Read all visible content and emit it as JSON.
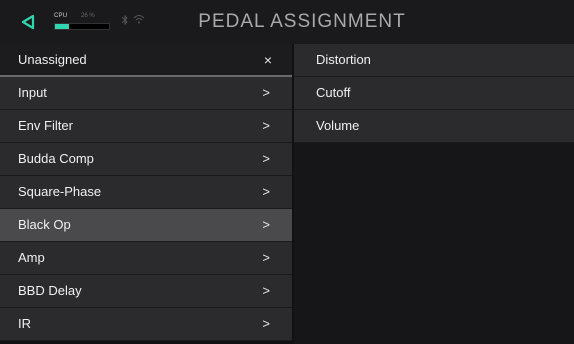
{
  "header": {
    "title": "PEDAL ASSIGNMENT",
    "cpu_label": "CPU",
    "cpu_percent": "26 %",
    "cpu_level": 0.26,
    "accent": "#2fd6b0",
    "icons": [
      "back-arrow-icon",
      "bluetooth-icon",
      "wifi-icon"
    ]
  },
  "left": {
    "unassigned": "Unassigned",
    "items": [
      {
        "label": "Input"
      },
      {
        "label": "Env Filter"
      },
      {
        "label": "Budda Comp"
      },
      {
        "label": "Square-Phase"
      },
      {
        "label": "Black Op",
        "selected": true
      },
      {
        "label": "Amp"
      },
      {
        "label": "BBD Delay"
      },
      {
        "label": "IR"
      }
    ],
    "chevron": ">",
    "close": "×"
  },
  "right": {
    "items": [
      {
        "label": "Distortion"
      },
      {
        "label": "Cutoff"
      },
      {
        "label": "Volume"
      }
    ]
  }
}
